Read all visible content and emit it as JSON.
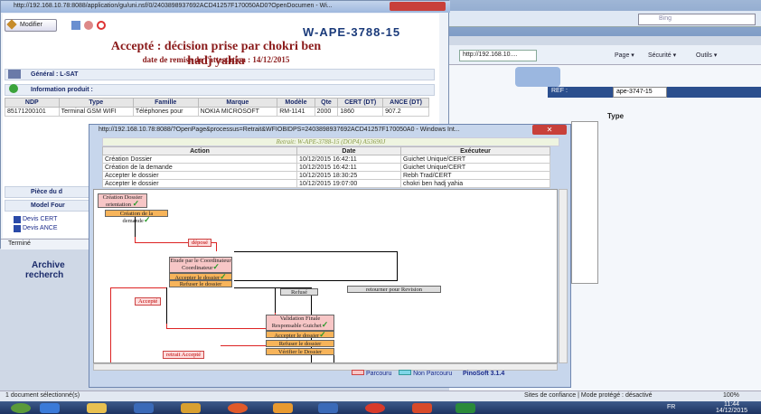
{
  "bg_browser": {
    "address": "http://192.168.10....",
    "search_placeholder": "Bing",
    "menus": [
      "Page ▾",
      "Sécurité ▾",
      "Outils ▾"
    ],
    "ref_label": "REF :",
    "ref_value": "ape-3747-15",
    "type_header": "Type"
  },
  "main": {
    "window_title": "http://192.168.10.78:8088/application/gu/uni.nsf/0/2403898937692ACD41257F170050AD0?OpenDocumen - Wi...",
    "modify_label": "Modifier",
    "code": "W-APE-3788-15",
    "title": "Accepté : décision prise par chokri ben hadj yahia",
    "subtitle": "date de remise de l'attestation : 14/12/2015",
    "general": "Général : L-SAT",
    "info_produit": "Information produit :",
    "table_headers": [
      "NDP",
      "Type",
      "Famille",
      "Marque",
      "Modèle",
      "Qte",
      "CERT (DT)",
      "ANCE (DT)"
    ],
    "table_rows": [
      [
        "85171200101",
        "Terminal GSM WIFI",
        "Téléphones pour",
        "NOKIA MICROSOFT",
        "RM-1141",
        "2000",
        "1860",
        "907.2"
      ]
    ],
    "piece": "Pièce du d",
    "model_fourni": "Model Four",
    "devis": [
      "Devis CERT",
      "Devis ANCE"
    ],
    "status": "Terminé",
    "archive": "Archive",
    "recherche": "recherch"
  },
  "popup": {
    "window_title": "http://192.168.10.78:8088/?OpenPage&processus=Retrait&WFIOBIDPS=2403898937692ACD41257F170050A0 - Windows Int...",
    "retrait": "Retrait: W-APE-3788-15 (DOP4) A53690J",
    "history_headers": [
      "Action",
      "Date",
      "Exécuteur"
    ],
    "history": [
      [
        "Création Dossier",
        "10/12/2015 16:42:11",
        "Guichet Unique/CERT"
      ],
      [
        "Création de la demande",
        "10/12/2015 16:42:11",
        "Guichet Unique/CERT"
      ],
      [
        "Accepter le dossier",
        "10/12/2015 18:30:25",
        "Rebh Trad/CERT"
      ],
      [
        "Accepter le dossier",
        "10/12/2015 19:07:00",
        "chokri ben hadj yahia"
      ]
    ],
    "nodes": {
      "creation_dossier": "Création Dossier orientation",
      "creation_demande": "Création de la demande",
      "depose": "déposé",
      "etude": "Etude par le Coordinateur Coordinateur",
      "accepter1": "Accepter le dossier",
      "refuser1": "Refuser le dossier",
      "refuse": "Refusé",
      "retourner": "retourner pour Revision",
      "accepte": "Accepté",
      "validation": "Validation Finale Responsable Guichet",
      "accepter2": "Accepter le dossier",
      "refuser2": "Refuser le dossier",
      "verifier": "Vérifier le Dossier",
      "retrait_accepte": "retrait Accepté"
    },
    "legend": {
      "parcouru": "Parcouru",
      "non_parcouru": "Non Parcouru",
      "brand": "PinoSoft 3.1.4"
    }
  },
  "ie_status": {
    "left": "1 document sélectionné(s)",
    "right": "Sites de confiance | Mode protégé : désactivé",
    "zoom": "100%"
  },
  "taskbar": {
    "lang": "FR",
    "time": "11:44",
    "date": "14/12/2015"
  }
}
